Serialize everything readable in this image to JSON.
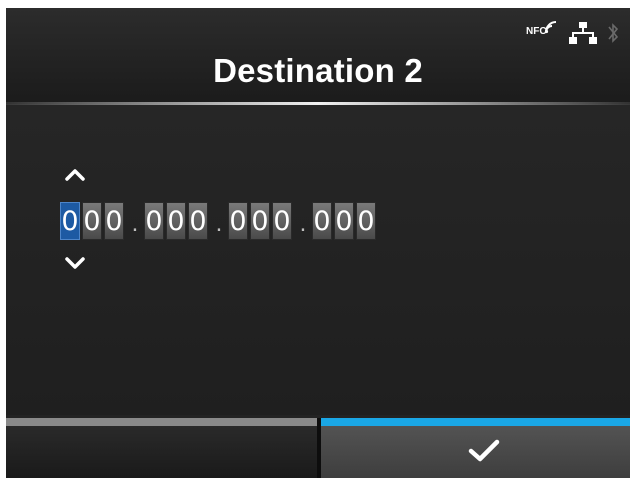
{
  "header": {
    "title": "Destination 2",
    "status_icons": {
      "nfc_label": "NFC",
      "lan": "lan-icon",
      "bluetooth": "bluetooth-icon"
    }
  },
  "ip_editor": {
    "octets": [
      [
        "0",
        "0",
        "0"
      ],
      [
        "0",
        "0",
        "0"
      ],
      [
        "0",
        "0",
        "0"
      ],
      [
        "0",
        "0",
        "0"
      ]
    ],
    "separator": ".",
    "selected_index": 0
  },
  "footer": {
    "left_button_label": "",
    "right_button_icon": "check-icon"
  },
  "colors": {
    "background": "#232323",
    "selected_digit": "#1d5aa3",
    "accent_bar": "#1aa7e6",
    "inactive_bar": "#8a8a8a"
  }
}
